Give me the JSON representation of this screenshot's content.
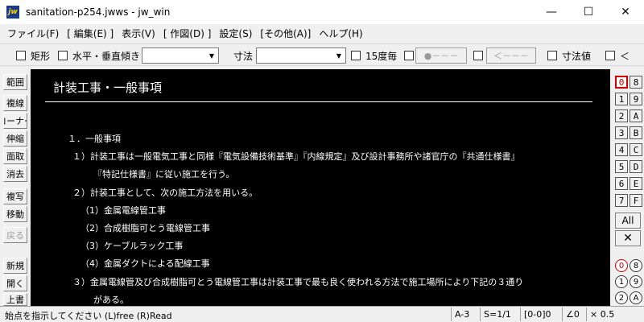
{
  "window": {
    "icon_text": "jw",
    "title": "sanitation-p254.jwws - jw_win",
    "minimize": "—",
    "maximize": "☐",
    "close": "✕"
  },
  "menu": [
    "ファイル(F)",
    "[ 編集(E) ]",
    "表示(V)",
    "[ 作図(D) ]",
    "設定(S)",
    "[その他(A)]",
    "ヘルプ(H)"
  ],
  "toolbar": {
    "rect_label": "矩形",
    "hv_label": "水平・垂直",
    "tilt_label": "傾き",
    "tilt_value": "",
    "dim_label": "寸法",
    "dim_value": "",
    "step15_label": "15度毎",
    "btn_dot": "●－－－",
    "btn_arrow": "＜－－－",
    "dimval_label": "寸法値",
    "lt_label": "＜"
  },
  "left_tools": [
    "範囲",
    "複線",
    "コーナー",
    "伸縮",
    "面取",
    "消去",
    "複写",
    "移動",
    "戻る",
    "新規",
    "開く",
    "上書"
  ],
  "document": {
    "title": "計装工事・一般事項",
    "lines": [
      "１．一般事項",
      "１）計装工事は一般電気工事と同様『電気設備技術基準』『内線規定』及び設計事務所や諸官庁の『共通仕様書』",
      "『特記仕様書』に従い施工を行う。",
      "２）計装工事として、次の施工方法を用いる。",
      "（1）金属電線管工事",
      "（2）合成樹脂可とう電線管工事",
      "（3）ケーブルラック工事",
      "（4）金属ダクトによる配線工事",
      "３）金属電線管及び合成樹脂可とう電線管工事は計装工事で最も良く使われる方法で施工場所により下記の３通り",
      "がある。"
    ]
  },
  "layers": {
    "left_col": [
      "0",
      "1",
      "2",
      "3",
      "4",
      "5",
      "6",
      "7"
    ],
    "right_col": [
      "8",
      "9",
      "A",
      "B",
      "C",
      "D",
      "E",
      "F"
    ],
    "active": "0",
    "all": "All",
    "x": "✕",
    "groups_left": [
      "0",
      "1",
      "2"
    ],
    "groups_right": [
      "8",
      "9",
      "A"
    ]
  },
  "status": {
    "message": "始点を指示してください (L)free (R)Read",
    "paper": "A-3",
    "scale": "S=1/1",
    "layer": "[0-0]0",
    "angle": "∠0",
    "zoom": "× 0.5"
  }
}
